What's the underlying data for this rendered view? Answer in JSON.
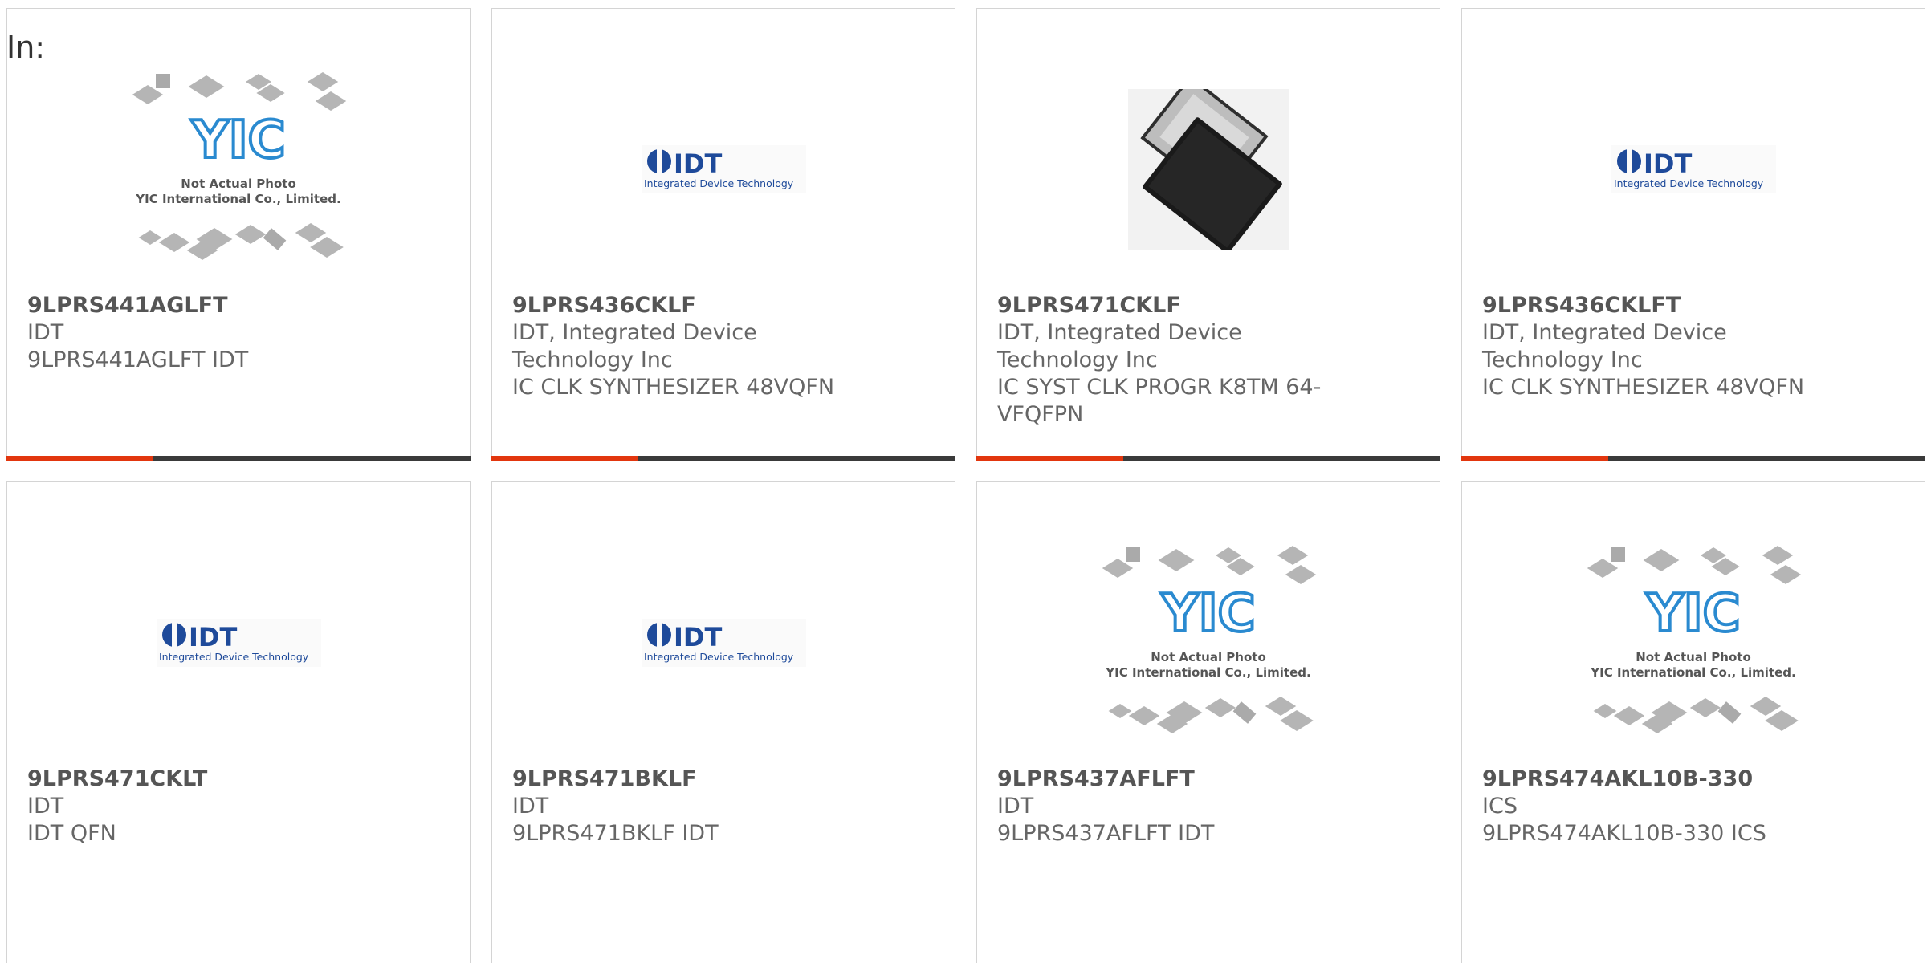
{
  "filter_label": "In:",
  "products": [
    {
      "part": "9LPRS441AGLFT",
      "manufacturer": "IDT",
      "description": "9LPRS441AGLFT IDT",
      "image": "yic-not-actual-photo"
    },
    {
      "part": "9LPRS436CKLF",
      "manufacturer": "IDT, Integrated Device Technology Inc",
      "description": "IC CLK SYNTHESIZER 48VQFN",
      "image": "idt-logo"
    },
    {
      "part": "9LPRS471CKLF",
      "manufacturer": "IDT, Integrated Device Technology Inc",
      "description": "IC SYST CLK PROGR K8TM 64-VFQFPN",
      "image": "qfn-chip-photo"
    },
    {
      "part": "9LPRS436CKLFT",
      "manufacturer": "IDT, Integrated Device Technology Inc",
      "description": "IC CLK SYNTHESIZER 48VQFN",
      "image": "idt-logo"
    },
    {
      "part": "9LPRS471CKLT",
      "manufacturer": "IDT",
      "description": "IDT QFN",
      "image": "idt-logo"
    },
    {
      "part": "9LPRS471BKLF",
      "manufacturer": "IDT",
      "description": "9LPRS471BKLF IDT",
      "image": "idt-logo"
    },
    {
      "part": "9LPRS437AFLFT",
      "manufacturer": "IDT",
      "description": "9LPRS437AFLFT IDT",
      "image": "yic-not-actual-photo"
    },
    {
      "part": "9LPRS474AKL10B-330",
      "manufacturer": "ICS",
      "description": "9LPRS474AKL10B-330 ICS",
      "image": "yic-not-actual-photo"
    }
  ],
  "image_text": {
    "idt_logo_name": "IDT",
    "idt_logo_tagline": "Integrated Device Technology",
    "yic_logo": "YIC",
    "yic_line1": "Not Actual Photo",
    "yic_line2": "YIC International Co., Limited."
  },
  "colors": {
    "accent_bar": "#e2360e",
    "bar_dark": "#3a3a3a",
    "idt_blue": "#1e4a9a",
    "yic_blue": "#2a8ad0"
  }
}
